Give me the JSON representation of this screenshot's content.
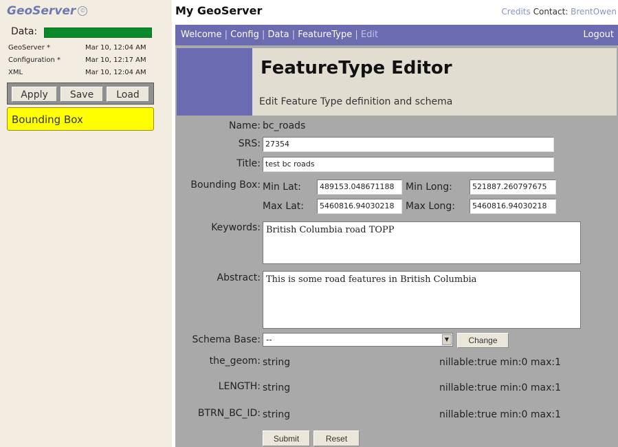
{
  "sidebar": {
    "logo": "GeoServer",
    "logo_mark": "©",
    "data_label": "Data:",
    "data_bar_color": "#0a8a2a",
    "status": [
      {
        "name": "GeoServer *",
        "time": "Mar 10, 12:04 AM"
      },
      {
        "name": "Configuration *",
        "time": "Mar 10, 12:17 AM"
      },
      {
        "name": "XML",
        "time": "Mar 10, 12:04 AM"
      }
    ],
    "buttons": {
      "apply": "Apply",
      "save": "Save",
      "load": "Load"
    },
    "active_item": "Bounding Box",
    "active_item_color": "#ffff00"
  },
  "header": {
    "title": "My GeoServer",
    "credits": "Credits",
    "contact_label": "Contact:",
    "contact_name": "BrentOwen"
  },
  "nav": {
    "items": [
      "Welcome",
      "Config",
      "Data",
      "FeatureType"
    ],
    "current": "Edit",
    "logout": "Logout",
    "bar_color": "#6a6bb0"
  },
  "editor": {
    "title": "FeatureType Editor",
    "subtitle": "Edit Feature Type definition and schema",
    "labels": {
      "name": "Name:",
      "srs": "SRS:",
      "title": "Title:",
      "bbox": "Bounding Box:",
      "min_lat": "Min Lat:",
      "min_long": "Min Long:",
      "max_lat": "Max Lat:",
      "max_long": "Max Long:",
      "keywords": "Keywords:",
      "abstract": "Abstract:",
      "schema_base": "Schema Base:"
    },
    "name_value": "bc_roads",
    "srs_value": "27354",
    "title_value": "test bc roads",
    "bbox": {
      "min_lat": "489153.048671188",
      "min_long": "521887.260797675",
      "max_lat": "5460816.94030218",
      "max_long": "5460816.94030218"
    },
    "keywords_value": "British Columbia road TOPP",
    "abstract_value": "This is some road features in British Columbia",
    "schema_base_value": "--",
    "change_button": "Change",
    "attributes": [
      {
        "name": "the_geom:",
        "type": "string",
        "info": "nillable:true min:0 max:1"
      },
      {
        "name": "LENGTH:",
        "type": "string",
        "info": "nillable:true min:0 max:1"
      },
      {
        "name": "BTRN_BC_ID:",
        "type": "string",
        "info": "nillable:true min:0 max:1"
      }
    ],
    "submit_button": "Submit",
    "reset_button": "Reset"
  }
}
